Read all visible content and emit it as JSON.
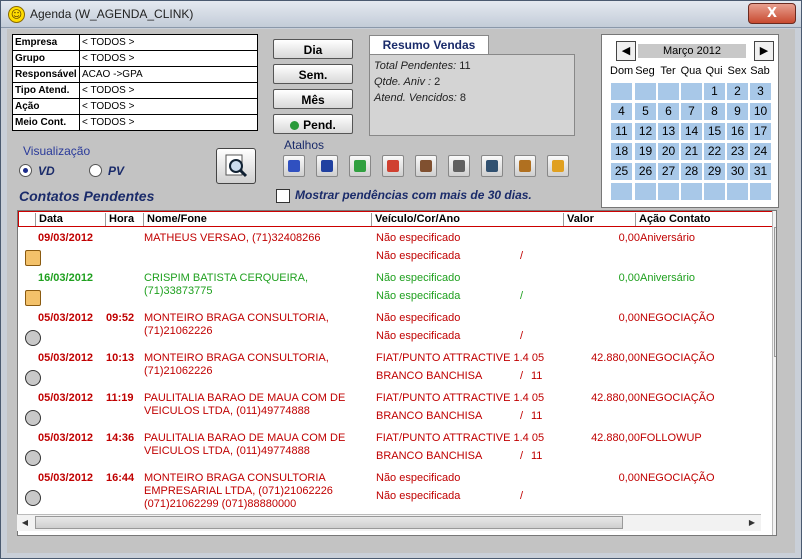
{
  "window": {
    "title": "Agenda (W_AGENDA_CLINK)",
    "close_label": "X"
  },
  "filters": [
    {
      "label": "Empresa",
      "value": "< TODOS >"
    },
    {
      "label": "Grupo",
      "value": "< TODOS >"
    },
    {
      "label": "Responsável",
      "value": "ACAO          ->GPA"
    },
    {
      "label": "Tipo Atend.",
      "value": "< TODOS >"
    },
    {
      "label": "Ação",
      "value": "< TODOS >"
    },
    {
      "label": "Meio Cont.",
      "value": "< TODOS >"
    }
  ],
  "buttons": {
    "dia": "Dia",
    "sem": "Sem.",
    "mes": "Mês",
    "pend": "Pend."
  },
  "resumo": {
    "tab": "Resumo Vendas",
    "total_label": "Total Pendentes:",
    "total_value": "11",
    "aniv_label": "Qtde. Aniv :",
    "aniv_value": "2",
    "vencidos_label": "Atend. Vencidos:",
    "vencidos_value": "8"
  },
  "calendar": {
    "month": "Março 2012",
    "weekdays": [
      "Dom",
      "Seg",
      "Ter",
      "Qua",
      "Qui",
      "Sex",
      "Sab"
    ],
    "weeks": [
      [
        "",
        "",
        "",
        "",
        "1",
        "2",
        "3"
      ],
      [
        "4",
        "5",
        "6",
        "7",
        "8",
        "9",
        "10"
      ],
      [
        "11",
        "12",
        "13",
        "14",
        "15",
        "16",
        "17"
      ],
      [
        "18",
        "19",
        "20",
        "21",
        "22",
        "23",
        "24"
      ],
      [
        "25",
        "26",
        "27",
        "28",
        "29",
        "30",
        "31"
      ],
      [
        "",
        "",
        "",
        "",
        "",
        "",
        ""
      ]
    ]
  },
  "visualizacao": {
    "label": "Visualização",
    "opt_vd": "VD",
    "opt_pv": "PV"
  },
  "atalhos": {
    "label": "Atalhos",
    "icons": [
      "shortcut-1-icon",
      "shortcut-2-icon",
      "shortcut-3-icon",
      "shortcut-4-icon",
      "shortcut-5-icon",
      "shortcut-6-icon",
      "shortcut-7-icon",
      "shortcut-8-icon",
      "shortcut-9-icon"
    ]
  },
  "section": {
    "title": "Contatos Pendentes",
    "checkbox_label": "Mostrar pendências com mais de 30 dias."
  },
  "grid": {
    "columns": [
      "Data",
      "Hora",
      "Nome/Fone",
      "Veículo/Cor/Ano",
      "Valor",
      "Ação Contato"
    ],
    "rows": [
      {
        "color": "red",
        "icon": "cake",
        "date": "09/03/2012",
        "time": "",
        "name1": "MATHEUS VERSAO, (71)32408266",
        "name2": "",
        "veh1": "Não especificado",
        "veh2": "Não especificada",
        "slash": "/",
        "year": "",
        "valor": "0,00",
        "acao": "Aniversário"
      },
      {
        "color": "green",
        "icon": "cake",
        "date": "16/03/2012",
        "time": "",
        "name1": "CRISPIM BATISTA CERQUEIRA,",
        "name2": "(71)33873775",
        "veh1": "Não especificado",
        "veh2": "Não especificada",
        "slash": "/",
        "year": "",
        "valor": "0,00",
        "acao": "Aniversário"
      },
      {
        "color": "red",
        "icon": "face",
        "date": "05/03/2012",
        "time": "09:52",
        "name1": "MONTEIRO BRAGA CONSULTORIA,",
        "name2": "(71)21062226",
        "veh1": "Não especificado",
        "veh2": "Não especificada",
        "slash": "/",
        "year": "",
        "valor": "0,00",
        "acao": "NEGOCIAÇÃO"
      },
      {
        "color": "red",
        "icon": "face",
        "date": "05/03/2012",
        "time": "10:13",
        "name1": "MONTEIRO BRAGA CONSULTORIA,",
        "name2": "(71)21062226",
        "veh1": "FIAT/PUNTO ATTRACTIVE 1.4  05",
        "veh2": "BRANCO BANCHISA",
        "slash": "/",
        "year": "11",
        "valor": "42.880,00",
        "acao": "NEGOCIAÇÃO"
      },
      {
        "color": "red",
        "icon": "face",
        "date": "05/03/2012",
        "time": "11:19",
        "name1": "PAULITALIA BARAO DE MAUA COM DE",
        "name2": "VEICULOS LTDA, (011)49774888",
        "veh1": "FIAT/PUNTO ATTRACTIVE 1.4  05",
        "veh2": "BRANCO BANCHISA",
        "slash": "/",
        "year": "11",
        "valor": "42.880,00",
        "acao": "NEGOCIAÇÃO"
      },
      {
        "color": "red",
        "icon": "face",
        "date": "05/03/2012",
        "time": "14:36",
        "name1": "PAULITALIA BARAO DE MAUA COM DE",
        "name2": "VEICULOS LTDA, (011)49774888",
        "veh1": "FIAT/PUNTO ATTRACTIVE 1.4  05",
        "veh2": "BRANCO BANCHISA",
        "slash": "/",
        "year": "11",
        "valor": "42.880,00",
        "acao": "FOLLOWUP"
      },
      {
        "color": "red",
        "icon": "face",
        "date": "05/03/2012",
        "time": "16:44",
        "name1": "MONTEIRO BRAGA CONSULTORIA",
        "name2": "EMPRESARIAL LTDA, (071)21062226",
        "name3": "(071)21062299 (071)88880000",
        "veh1": "Não especificado",
        "veh2": "Não especificada",
        "slash": "/",
        "year": "",
        "valor": "0,00",
        "acao": "NEGOCIAÇÃO"
      }
    ]
  },
  "colors": {
    "red": "#c00000",
    "green": "#1fa01f",
    "accent": "#1a2b6a",
    "calendar_day": "#a8c8e8"
  }
}
